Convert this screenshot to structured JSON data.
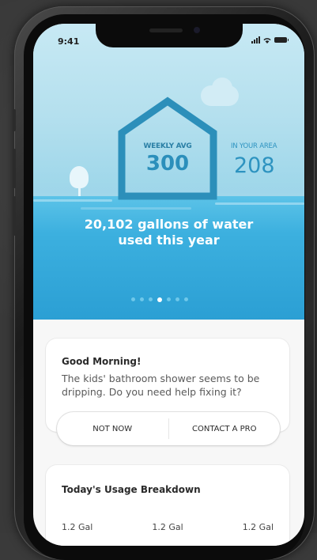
{
  "status": {
    "time": "9:41"
  },
  "hero": {
    "weekly_avg_label": "WEEKLY AVG",
    "weekly_avg_value": "300",
    "area_label": "IN YOUR AREA",
    "area_value": "208",
    "headline_line1": "20,102 gallons of water",
    "headline_line2": "used this year",
    "pager": {
      "count": 7,
      "active_index": 3
    }
  },
  "greeting_card": {
    "title": "Good Morning!",
    "message": "The kids' bathroom shower seems to be dripping. Do you need help fixing it?",
    "not_now_label": "NOT NOW",
    "contact_label": "CONTACT A PRO"
  },
  "usage_card": {
    "title": "Today's Usage Breakdown",
    "values": [
      "1.2 Gal",
      "1.2 Gal",
      "1.2 Gal"
    ]
  },
  "colors": {
    "accent": "#2b8fbb",
    "water": "#2a9fd3",
    "sky": "#c7e9f4"
  }
}
